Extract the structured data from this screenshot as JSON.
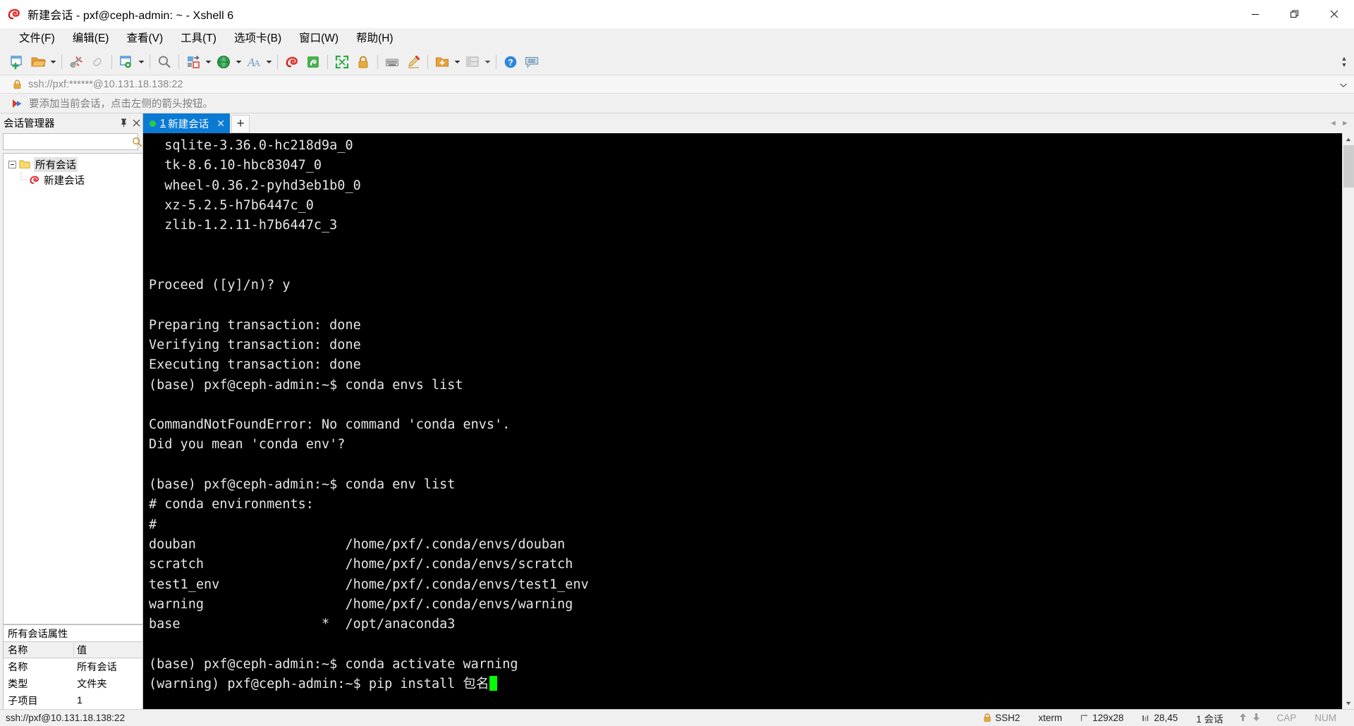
{
  "window": {
    "title": "新建会话 - pxf@ceph-admin: ~ - Xshell 6",
    "app_icon": "xshell-logo-icon",
    "minimize_label": "最小化",
    "maximize_label": "还原",
    "close_label": "关闭"
  },
  "menubar": {
    "items": [
      {
        "label": "文件(F)",
        "name": "menu-file"
      },
      {
        "label": "编辑(E)",
        "name": "menu-edit"
      },
      {
        "label": "查看(V)",
        "name": "menu-view"
      },
      {
        "label": "工具(T)",
        "name": "menu-tools"
      },
      {
        "label": "选项卡(B)",
        "name": "menu-tabs"
      },
      {
        "label": "窗口(W)",
        "name": "menu-window"
      },
      {
        "label": "帮助(H)",
        "name": "menu-help"
      }
    ]
  },
  "toolbar": {
    "overflow_label": "»",
    "buttons": [
      {
        "name": "new-session-icon",
        "tip": "新建"
      },
      {
        "name": "open-folder-icon",
        "tip": "打开"
      },
      {
        "name": "disconnect-icon",
        "tip": "断开"
      },
      {
        "name": "reconnect-icon",
        "tip": "重新连接"
      },
      {
        "name": "session-properties-icon",
        "tip": "属性"
      },
      {
        "name": "find-icon",
        "tip": "查找"
      },
      {
        "name": "layout-icon",
        "tip": "排列"
      },
      {
        "name": "globe-icon",
        "tip": "编码"
      },
      {
        "name": "font-icon",
        "tip": "字体"
      },
      {
        "name": "xshell-icon",
        "tip": "Xshell"
      },
      {
        "name": "xftp-icon",
        "tip": "Xftp"
      },
      {
        "name": "fullscreen-icon",
        "tip": "全屏"
      },
      {
        "name": "lock-icon",
        "tip": "锁定"
      },
      {
        "name": "keyboard-icon",
        "tip": "键盘"
      },
      {
        "name": "highlight-icon",
        "tip": "高亮"
      },
      {
        "name": "folder-add-icon",
        "tip": "添加到文件夹"
      },
      {
        "name": "panel-layout-icon",
        "tip": "面板布局"
      },
      {
        "name": "help-icon",
        "tip": "帮助"
      },
      {
        "name": "feedback-icon",
        "tip": "反馈"
      }
    ]
  },
  "address_bar": {
    "value": "ssh://pxf:******@10.131.18.138:22",
    "lock_icon": "lock-icon",
    "dropdown_icon": "chevron-down-icon"
  },
  "notice_bar": {
    "icon": "arrow-flag-icon",
    "text": "要添加当前会话，点击左侧的箭头按钮。"
  },
  "sidebar": {
    "title": "会话管理器",
    "pin_label": "⊥",
    "close_label": "✕",
    "search": {
      "value": "",
      "placeholder": ""
    },
    "search_icon": "search-icon",
    "tree": [
      {
        "label": "所有会话",
        "icon": "folder-icon",
        "level": 1,
        "expanded": true,
        "selected": true
      },
      {
        "label": "新建会话",
        "icon": "xshell-session-icon",
        "level": 2,
        "expanded": false,
        "selected": false
      }
    ],
    "properties": {
      "title": "所有会话属性",
      "headers": [
        "名称",
        "值"
      ],
      "rows": [
        [
          "名称",
          "所有会话"
        ],
        [
          "类型",
          "文件夹"
        ],
        [
          "子项目",
          "1"
        ]
      ]
    }
  },
  "tabs": {
    "items": [
      {
        "number": "1",
        "label": "新建会话",
        "active": true,
        "status": "connected",
        "close_label": "✕"
      }
    ],
    "add_label": "+",
    "nav_prev": "◄",
    "nav_next": "►"
  },
  "terminal": {
    "lines": [
      "  sqlite-3.36.0-hc218d9a_0",
      "  tk-8.6.10-hbc83047_0",
      "  wheel-0.36.2-pyhd3eb1b0_0",
      "  xz-5.2.5-h7b6447c_0",
      "  zlib-1.2.11-h7b6447c_3",
      "",
      "",
      "Proceed ([y]/n)? y",
      "",
      "Preparing transaction: done",
      "Verifying transaction: done",
      "Executing transaction: done",
      "(base) pxf@ceph-admin:~$ conda envs list",
      "",
      "CommandNotFoundError: No command 'conda envs'.",
      "Did you mean 'conda env'?",
      "",
      "(base) pxf@ceph-admin:~$ conda env list",
      "# conda environments:",
      "#",
      "douban                   /home/pxf/.conda/envs/douban",
      "scratch                  /home/pxf/.conda/envs/scratch",
      "test1_env                /home/pxf/.conda/envs/test1_env",
      "warning                  /home/pxf/.conda/envs/warning",
      "base                  *  /opt/anaconda3",
      ""
    ],
    "last_line": "(warning) pxf@ceph-admin:~$ pip install 包名",
    "second_last_line": "(base) pxf@ceph-admin:~$ conda activate warning",
    "cursor": "block-cursor",
    "cursor_color": "#00ff00",
    "background": "#000000",
    "foreground": "#e6e6e6"
  },
  "statusbar": {
    "connection": "ssh://pxf@10.131.18.138:22",
    "protocol": "SSH2",
    "protocol_icon": "lock-icon",
    "terminal_type": "xterm",
    "size": "129x28",
    "size_icon": "resize-icon",
    "cursor_pos": "28,45",
    "cursor_icon": "ruler-icon",
    "sessions": "1 会话",
    "transfer_icons": [
      "upload-arrow-icon",
      "download-arrow-icon"
    ],
    "cap": "CAP",
    "num": "NUM"
  }
}
